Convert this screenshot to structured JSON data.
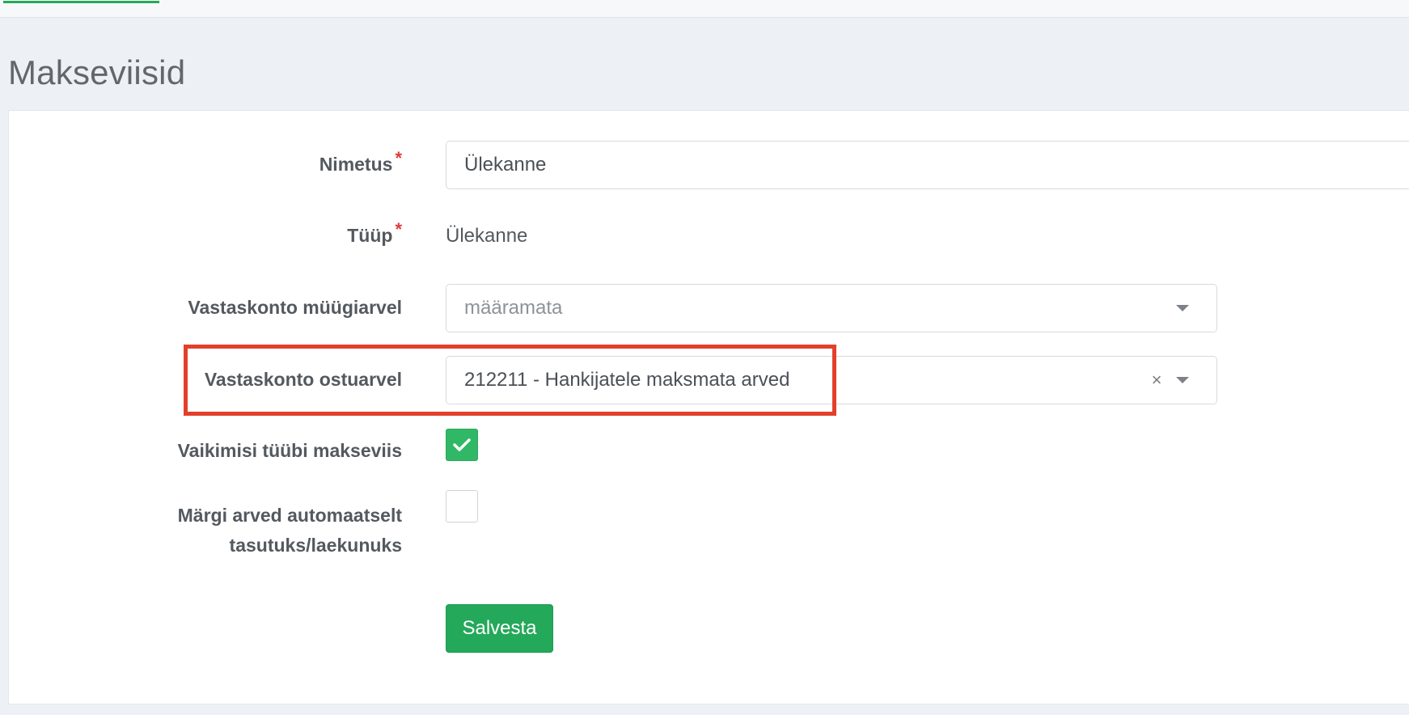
{
  "page": {
    "title": "Makseviisid"
  },
  "form": {
    "name": {
      "label": "Nimetus",
      "required_mark": "*",
      "value": "Ülekanne"
    },
    "type": {
      "label": "Tüüp",
      "required_mark": "*",
      "value": "Ülekanne"
    },
    "sales_account": {
      "label": "Vastaskonto müügiarvel",
      "placeholder": "määramata"
    },
    "purchase_account": {
      "label": "Vastaskonto ostuarvel",
      "value": "212211 - Hankijatele maksmata arved"
    },
    "default_type": {
      "label": "Vaikimisi tüübi makseviis",
      "checked": true
    },
    "auto_mark_paid": {
      "label_line1": "Märgi arved automaatselt",
      "label_line2": "tasutuks/laekunuks",
      "checked": false
    },
    "save_label": "Salvesta"
  },
  "colors": {
    "accent": "#24a85a",
    "highlight": "#e2402b",
    "required": "#e03a3a"
  },
  "icons": {
    "clear": "close-icon",
    "dropdown": "chevron-down-icon",
    "check": "checkmark-icon"
  }
}
